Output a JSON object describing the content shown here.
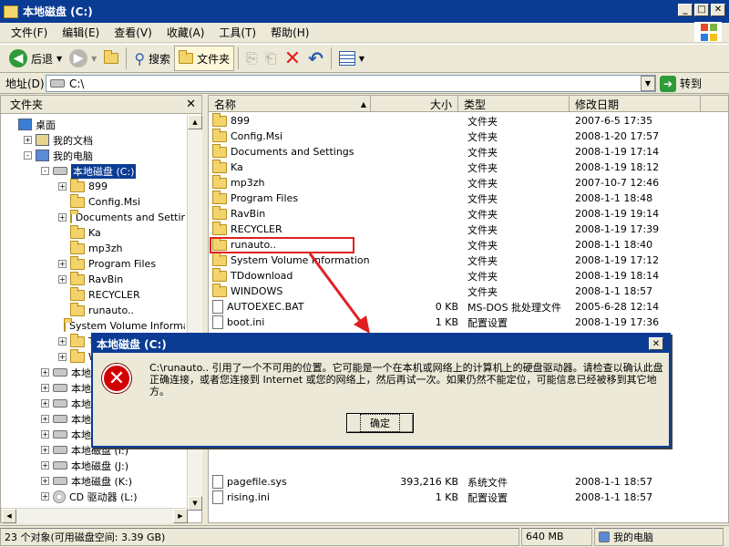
{
  "window": {
    "title": "本地磁盘 (C:)",
    "minimize": "_",
    "maximize": "□",
    "close": "✕"
  },
  "menu": [
    "文件(F)",
    "编辑(E)",
    "查看(V)",
    "收藏(A)",
    "工具(T)",
    "帮助(H)"
  ],
  "toolbar": {
    "back_label": "后退",
    "search_label": "搜索",
    "folders_label": "文件夹"
  },
  "address": {
    "label": "地址(D)",
    "value": "C:\\",
    "go_label": "转到"
  },
  "left_panel": {
    "title": "文件夹",
    "close": "✕",
    "tree": [
      {
        "label": "桌面",
        "icon": "desktop-icon",
        "indent": 0,
        "expander": ""
      },
      {
        "label": "我的文档",
        "icon": "documents-icon",
        "indent": 1,
        "expander": "+"
      },
      {
        "label": "我的电脑",
        "icon": "computer-icon",
        "indent": 1,
        "expander": "-"
      },
      {
        "label": "本地磁盘 (C:)",
        "icon": "drive-icon",
        "indent": 2,
        "expander": "-",
        "selected": true
      },
      {
        "label": "899",
        "icon": "folder-icon",
        "indent": 3,
        "expander": "+"
      },
      {
        "label": "Config.Msi",
        "icon": "folder-icon",
        "indent": 3,
        "expander": ""
      },
      {
        "label": "Documents and Settings",
        "icon": "folder-icon",
        "indent": 3,
        "expander": "+"
      },
      {
        "label": "Ka",
        "icon": "folder-icon",
        "indent": 3,
        "expander": ""
      },
      {
        "label": "mp3zh",
        "icon": "folder-icon",
        "indent": 3,
        "expander": ""
      },
      {
        "label": "Program Files",
        "icon": "folder-icon",
        "indent": 3,
        "expander": "+"
      },
      {
        "label": "RavBin",
        "icon": "folder-icon",
        "indent": 3,
        "expander": "+"
      },
      {
        "label": "RECYCLER",
        "icon": "folder-icon",
        "indent": 3,
        "expander": ""
      },
      {
        "label": "runauto..",
        "icon": "folder-icon",
        "indent": 3,
        "expander": ""
      },
      {
        "label": "System Volume Informati",
        "icon": "folder-icon",
        "indent": 3,
        "expander": ""
      },
      {
        "label": "TD",
        "icon": "folder-icon",
        "indent": 3,
        "expander": "+"
      },
      {
        "label": "W",
        "icon": "folder-icon",
        "indent": 3,
        "expander": "+"
      },
      {
        "label": "本地磁",
        "icon": "drive-icon",
        "indent": 2,
        "expander": "+"
      },
      {
        "label": "本地磁",
        "icon": "drive-icon",
        "indent": 2,
        "expander": "+"
      },
      {
        "label": "本地磁",
        "icon": "drive-icon",
        "indent": 2,
        "expander": "+"
      },
      {
        "label": "本地磁",
        "icon": "drive-icon",
        "indent": 2,
        "expander": "+"
      },
      {
        "label": "本地磁",
        "icon": "drive-icon",
        "indent": 2,
        "expander": "+"
      },
      {
        "label": "本地磁盘 (I:)",
        "icon": "drive-icon",
        "indent": 2,
        "expander": "+"
      },
      {
        "label": "本地磁盘 (J:)",
        "icon": "drive-icon",
        "indent": 2,
        "expander": "+"
      },
      {
        "label": "本地磁盘 (K:)",
        "icon": "drive-icon",
        "indent": 2,
        "expander": "+"
      },
      {
        "label": "CD 驱动器 (L:)",
        "icon": "cd-icon",
        "indent": 2,
        "expander": "+"
      }
    ]
  },
  "file_list": {
    "columns": [
      "名称",
      "大小",
      "类型",
      "修改日期"
    ],
    "sort_indicator": "▲",
    "rows": [
      {
        "name": "899",
        "size": "",
        "type": "文件夹",
        "date": "2007-6-5 17:35",
        "icon": "folder-icon"
      },
      {
        "name": "Config.Msi",
        "size": "",
        "type": "文件夹",
        "date": "2008-1-20 17:57",
        "icon": "folder-icon"
      },
      {
        "name": "Documents and Settings",
        "size": "",
        "type": "文件夹",
        "date": "2008-1-19 17:14",
        "icon": "folder-icon"
      },
      {
        "name": "Ka",
        "size": "",
        "type": "文件夹",
        "date": "2008-1-19 18:12",
        "icon": "folder-icon"
      },
      {
        "name": "mp3zh",
        "size": "",
        "type": "文件夹",
        "date": "2007-10-7 12:46",
        "icon": "folder-icon"
      },
      {
        "name": "Program Files",
        "size": "",
        "type": "文件夹",
        "date": "2008-1-1 18:48",
        "icon": "folder-icon"
      },
      {
        "name": "RavBin",
        "size": "",
        "type": "文件夹",
        "date": "2008-1-19 19:14",
        "icon": "folder-icon"
      },
      {
        "name": "RECYCLER",
        "size": "",
        "type": "文件夹",
        "date": "2008-1-19 17:39",
        "icon": "folder-icon"
      },
      {
        "name": "runauto..",
        "size": "",
        "type": "文件夹",
        "date": "2008-1-1 18:40",
        "icon": "folder-icon"
      },
      {
        "name": "System Volume Information",
        "size": "",
        "type": "文件夹",
        "date": "2008-1-19 17:12",
        "icon": "folder-icon"
      },
      {
        "name": "TDdownload",
        "size": "",
        "type": "文件夹",
        "date": "2008-1-19 18:14",
        "icon": "folder-icon"
      },
      {
        "name": "WINDOWS",
        "size": "",
        "type": "文件夹",
        "date": "2008-1-1 18:57",
        "icon": "folder-icon"
      },
      {
        "name": "AUTOEXEC.BAT",
        "size": "0 KB",
        "type": "MS-DOS 批处理文件",
        "date": "2005-6-28 12:14",
        "icon": "file-icon"
      },
      {
        "name": "boot.ini",
        "size": "1 KB",
        "type": "配置设置",
        "date": "2008-1-19 17:36",
        "icon": "file-icon"
      },
      {
        "name": "pagefile.sys",
        "size": "393,216 KB",
        "type": "系统文件",
        "date": "2008-1-1 18:57",
        "icon": "file-icon"
      },
      {
        "name": "rising.ini",
        "size": "1 KB",
        "type": "配置设置",
        "date": "2008-1-1 18:57",
        "icon": "file-icon"
      }
    ]
  },
  "status": {
    "objects": "23 个对象(可用磁盘空间: 3.39 GB)",
    "size": "640 MB",
    "location": "我的电脑"
  },
  "dialog": {
    "title": "本地磁盘 (C:)",
    "close": "✕",
    "icon_text": "✕",
    "message": "C:\\runauto.. 引用了一个不可用的位置。它可能是一个在本机或网络上的计算机上的硬盘驱动器。请检查以确认此盘正确连接，或者您连接到 Internet 或您的网络上，然后再试一次。如果仍然不能定位，可能信息已经被移到其它地方。",
    "ok_label": "确定"
  },
  "colors": {
    "title_blue": "#0b3c94",
    "annotation_red": "#e02020",
    "error_red": "#d20000"
  }
}
